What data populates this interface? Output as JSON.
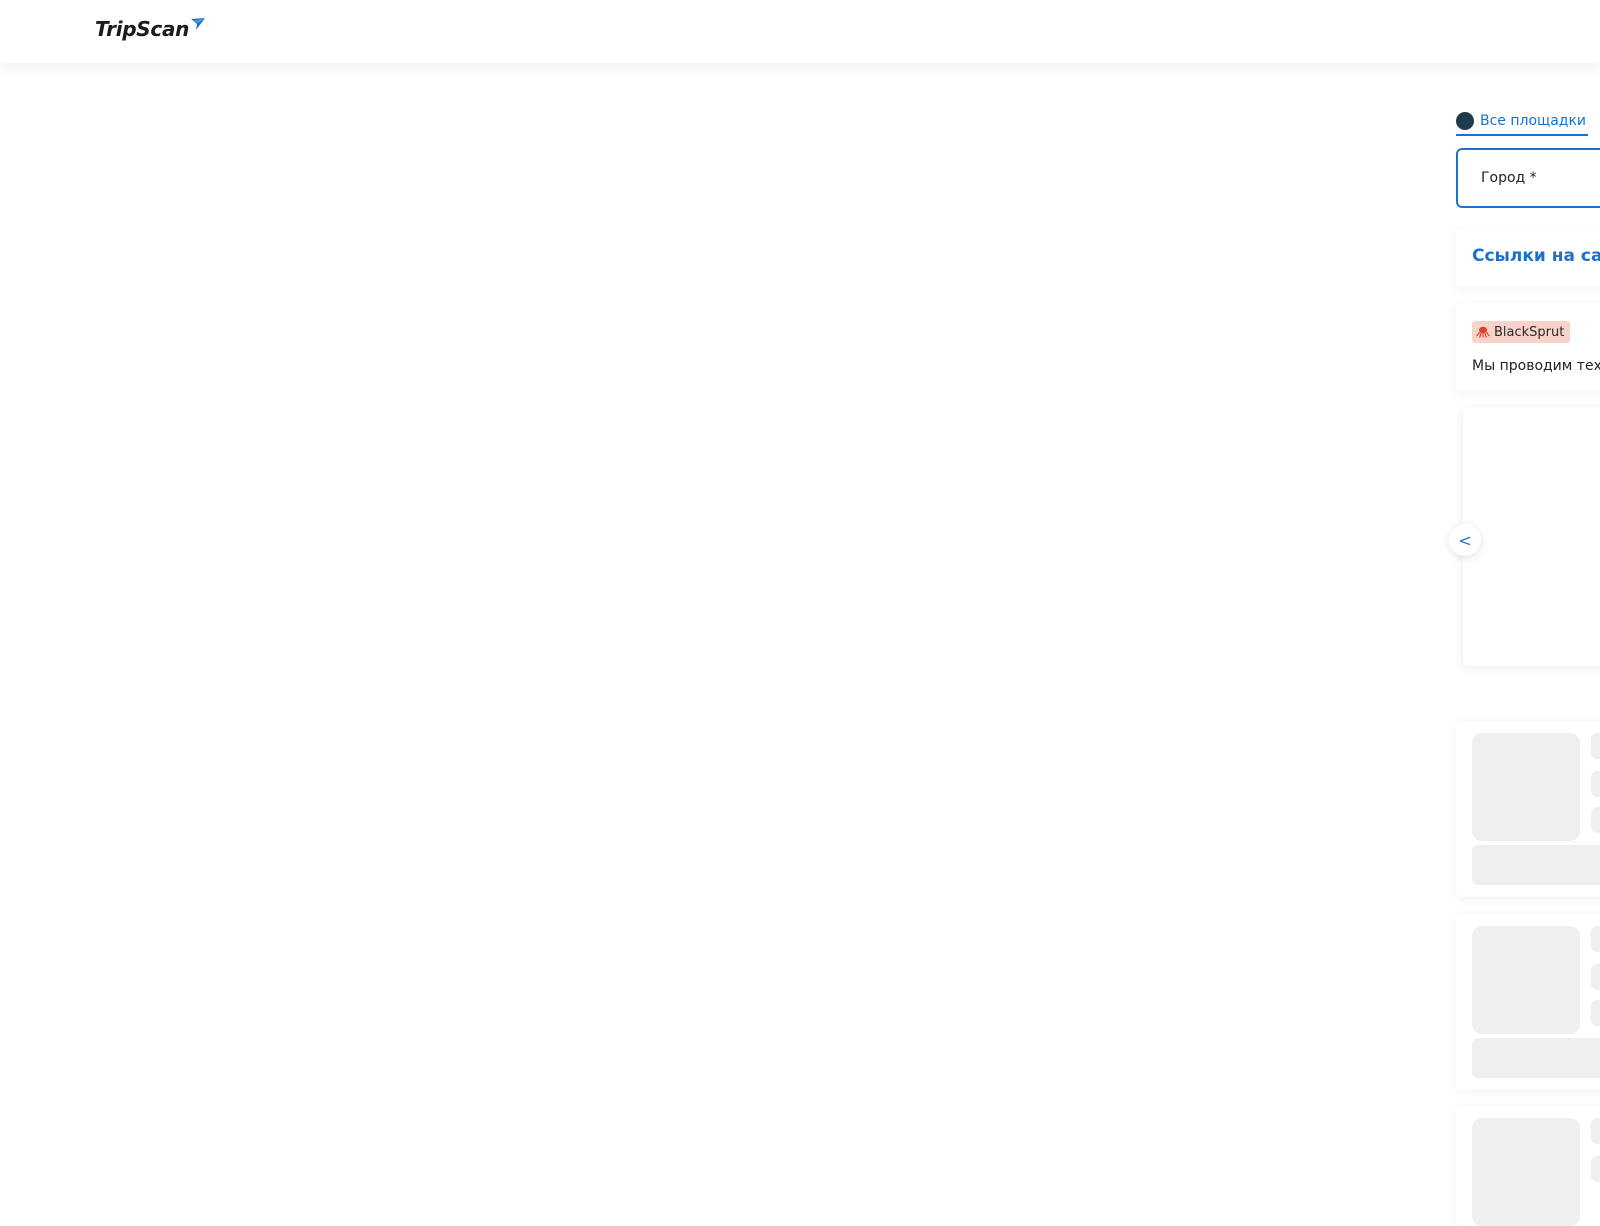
{
  "header": {
    "logo_text": "TripScan"
  },
  "colors": {
    "accent": "#1d72c7",
    "badge_bg": "#f8d3ca",
    "skeleton": "#efefef"
  },
  "platform_tab": {
    "label": "Все площадки",
    "icon": "globe-icon"
  },
  "city_field": {
    "label": "Город *"
  },
  "links_card": {
    "title": "Ссылки на са"
  },
  "notice": {
    "badge": "BlackSprut",
    "badge_icon": "octopus-icon",
    "text": "Мы проводим тех"
  },
  "slider": {
    "prev_label": "<"
  }
}
